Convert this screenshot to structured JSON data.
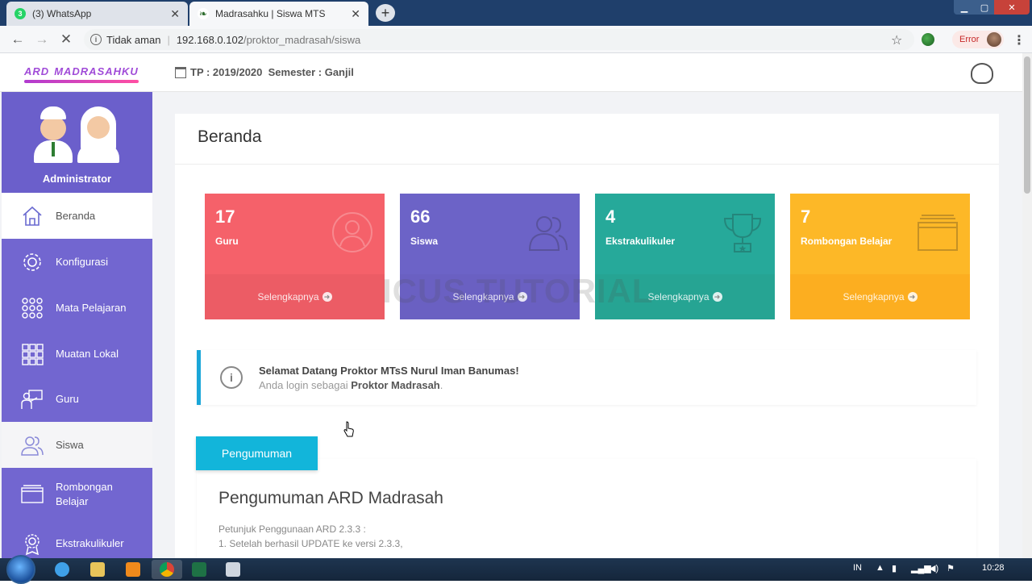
{
  "browser": {
    "tabs": [
      {
        "title": "(3) WhatsApp",
        "active": false
      },
      {
        "title": "Madrasahku | Siswa MTS",
        "active": true
      }
    ],
    "security_label": "Tidak aman",
    "url_host": "192.168.0.102",
    "url_path": "/proktor_madrasah/siswa",
    "profile_status": "Error"
  },
  "header": {
    "logo_main": "ARD",
    "logo_sub": "MADRASAHKU",
    "tp_text": "TP : 2019/2020",
    "semester_text": "Semester : Ganjil"
  },
  "sidebar": {
    "role": "Administrator",
    "items": [
      {
        "label": "Beranda",
        "icon": "home-icon"
      },
      {
        "label": "Konfigurasi",
        "icon": "gear-icon"
      },
      {
        "label": "Mata Pelajaran",
        "icon": "dots-grid-icon"
      },
      {
        "label": "Muatan Lokal",
        "icon": "grid-icon"
      },
      {
        "label": "Guru",
        "icon": "teacher-icon"
      },
      {
        "label": "Siswa",
        "icon": "users-icon"
      },
      {
        "label": "Rombongan Belajar",
        "icon": "folder-icon"
      },
      {
        "label": "Ekstrakulikuler",
        "icon": "medal-icon"
      }
    ]
  },
  "main": {
    "title": "Beranda",
    "stats": [
      {
        "value": "17",
        "label": "Guru",
        "more": "Selengkapnya",
        "color": "#f5616a"
      },
      {
        "value": "66",
        "label": "Siswa",
        "more": "Selengkapnya",
        "color": "#6c63c7"
      },
      {
        "value": "4",
        "label": "Ekstrakulikuler",
        "more": "Selengkapnya",
        "color": "#26a99a"
      },
      {
        "value": "7",
        "label": "Rombongan Belajar",
        "more": "Selengkapnya",
        "color": "#fdb827"
      }
    ],
    "watermark": "ICUS TUTORIAL",
    "welcome": {
      "line1": "Selamat Datang Proktor MTsS Nurul Iman Banumas!",
      "line2_prefix": "Anda login sebagai",
      "line2_role": "Proktor Madrasah",
      "line2_suffix": "."
    },
    "announcement": {
      "tab_label": "Pengumuman",
      "title": "Pengumuman ARD Madrasah",
      "text1": "Petunjuk Penggunaan ARD 2.3.3 :",
      "text2": "1. Setelah berhasil UPDATE ke versi 2.3.3,"
    }
  },
  "taskbar": {
    "lang": "IN",
    "time": "10:28"
  }
}
